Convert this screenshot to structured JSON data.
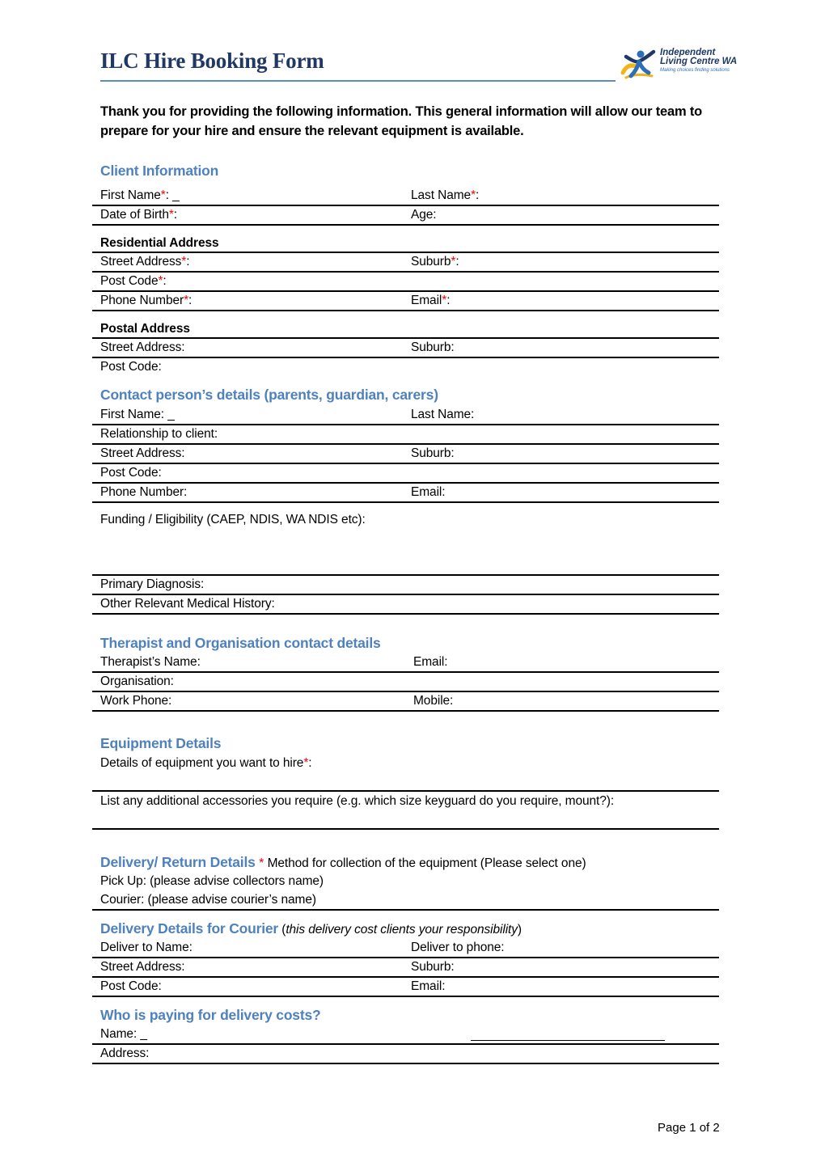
{
  "header": {
    "title": "ILC Hire Booking Form",
    "logo": {
      "line1": "Independent",
      "line2": "Living Centre WA",
      "tagline": "Making choices finding solutions",
      "icon": "person-figure-logo-icon",
      "colors": {
        "navy": "#1f3864",
        "blue": "#2f6eb5",
        "gold": "#f2b21a"
      }
    },
    "rule_color": "#5b8ac6"
  },
  "intro": "Thank you for providing the following information. This general information will allow our team to prepare for your hire and ensure the relevant equipment is available.",
  "colors": {
    "heading": "#4f81bd",
    "required": "#ff0000",
    "title": "#1f3864"
  },
  "required_mark": "*",
  "client": {
    "heading": "Client Information",
    "first_name": "First Name",
    "first_name_suffix": ": _",
    "last_name": "Last Name",
    "dob": "Date of Birth",
    "age": "Age:",
    "residential": {
      "heading": "Residential Address",
      "street": "Street Address",
      "suburb": "Suburb",
      "postcode": "Post Code",
      "phone": "Phone Number",
      "email": "Email"
    },
    "postal": {
      "heading": "Postal Address",
      "street": "Street Address:",
      "suburb": "Suburb:",
      "postcode": "Post Code:"
    }
  },
  "contact": {
    "heading": "Contact person’s details (parents, guardian, carers)",
    "first_name": "First Name: _",
    "last_name": "Last Name:",
    "relationship": "Relationship to client:",
    "street": "Street Address:",
    "suburb": "Suburb:",
    "postcode": "Post Code:",
    "phone": "Phone Number:",
    "email": "Email:"
  },
  "funding": "Funding / Eligibility (CAEP, NDIS, WA NDIS etc):",
  "medical": {
    "primary": "Primary Diagnosis:",
    "other": "Other Relevant Medical History:"
  },
  "therapist": {
    "heading": "Therapist and Organisation contact details",
    "name": "Therapist’s Name:",
    "email": "Email:",
    "organisation": "Organisation:",
    "work_phone": "Work Phone:",
    "mobile": "Mobile:"
  },
  "equipment": {
    "heading": "Equipment Details",
    "details": "Details of equipment you want to hire",
    "accessories": "List any additional accessories you require (e.g. which size keyguard do you require, mount?):"
  },
  "delivery": {
    "heading": "Delivery/ Return Details",
    "method": " Method for collection of the equipment (Please select one)",
    "pickup": "Pick Up: (please advise collectors name)",
    "courier": "Courier: (please advise courier’s name)"
  },
  "courier": {
    "heading": "Delivery Details for Courier",
    "note_open": " (",
    "note": "this delivery cost clients your responsibility",
    "note_close": ")",
    "deliver_name": "Deliver to Name:",
    "deliver_phone": "Deliver to phone:",
    "street": "Street Address:",
    "suburb": "Suburb:",
    "postcode": "Post Code:",
    "email": "Email:"
  },
  "payer": {
    "heading": "Who is paying for delivery costs?",
    "name": "Name: _",
    "address": "Address:"
  },
  "footer": {
    "page": "Page 1 of 2"
  }
}
